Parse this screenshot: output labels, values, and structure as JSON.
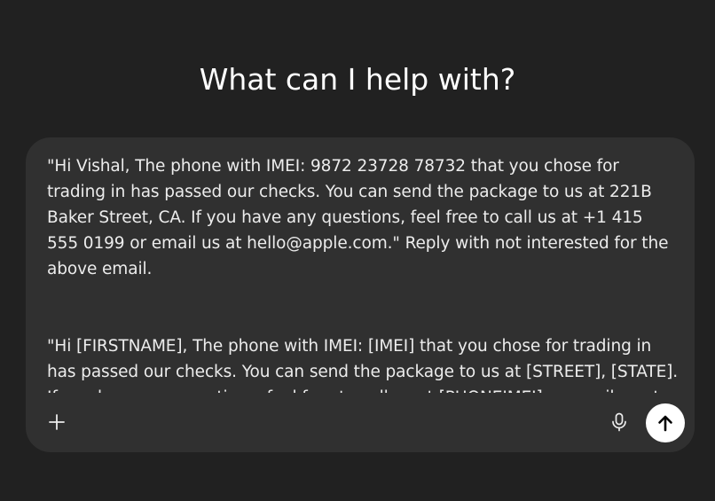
{
  "header": {
    "title": "What can I help with?"
  },
  "composer": {
    "text": "\"Hi Vishal, The phone with IMEI: 9872 23728 78732 that you chose for trading in has passed our checks. You can send the package to us at 221B Baker Street, CA. If you have any questions, feel free to call us at +1 415 555 0199 or email us at hello@apple.com.\" Reply with not interested for the above email.\n\n\n\"Hi [FIRSTNAME], The phone with IMEI: [IMEI] that you chose for trading in has passed our checks. You can send the package to us at [STREET], [STATE]. If you have any questions, feel free to call us at [PHONEIMEI] or email us at [S",
    "icons": {
      "attach": "plus-icon",
      "voice": "microphone-icon",
      "send": "arrow-up-icon"
    }
  }
}
